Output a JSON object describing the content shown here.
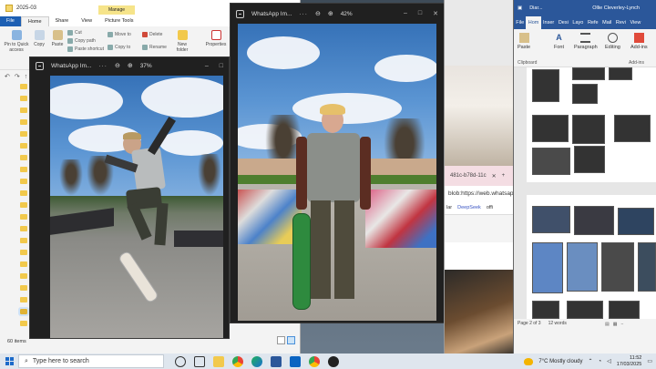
{
  "explorer": {
    "title": "2025-03",
    "manage": "Manage",
    "tabs": [
      "File",
      "Home",
      "Share",
      "View",
      "Picture Tools"
    ],
    "ribbon": {
      "pin": "Pin to Quick access",
      "copy": "Copy",
      "paste": "Paste",
      "cut": "Cut",
      "copy_path": "Copy path",
      "paste_shortcut": "Paste shortcut",
      "move_to": "Move to",
      "copy_to": "Copy to",
      "delete": "Delete",
      "rename": "Rename",
      "new_folder": "New folder",
      "properties": "Properties"
    },
    "status": "60 items"
  },
  "viewer1": {
    "title": "WhatsApp Im...",
    "zoom": "37%"
  },
  "viewer2": {
    "title": "WhatsApp Im...",
    "zoom": "42%"
  },
  "browser": {
    "tab_title": "481c-b78d-11c",
    "address": "blob:https://web.whatsap",
    "favorites": [
      "lar",
      "DeepSeek",
      "offi"
    ]
  },
  "word": {
    "title": "Diar...",
    "user": "Ollie Cleverley-Lynch",
    "tabs": [
      "File",
      "Hom",
      "Inser",
      "Desi",
      "Layo",
      "Refe",
      "Mail",
      "Revi",
      "View"
    ],
    "ribbon": {
      "paste": "Paste",
      "font": "Font",
      "paragraph": "Paragraph",
      "editing": "Editing",
      "addins": "Add-ins"
    },
    "groups": {
      "clipboard": "Clipboard",
      "addins": "Add-ins"
    },
    "status": {
      "page": "Page 2 of 3",
      "words": "12 words"
    }
  },
  "taskbar": {
    "search_placeholder": "Type here to search",
    "weather": "7°C  Mostly cloudy",
    "time": "11:52",
    "date": "17/03/2025"
  },
  "colors": {
    "word_blue": "#2b579a",
    "viewer_bg": "#202020",
    "explorer_file_tab": "#1d5fb3"
  }
}
